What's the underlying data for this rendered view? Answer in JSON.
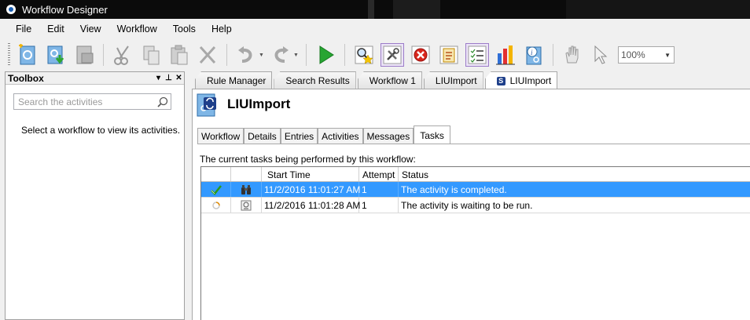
{
  "window": {
    "title": "Workflow Designer"
  },
  "menu": [
    "File",
    "Edit",
    "View",
    "Workflow",
    "Tools",
    "Help"
  ],
  "toolbar": {
    "zoom": "100%"
  },
  "toolbox": {
    "title": "Toolbox",
    "search_placeholder": "Search the activities",
    "empty_message": "Select a workflow to view its activities."
  },
  "doc_tabs": [
    {
      "label": "Rule Manager"
    },
    {
      "label": "Search Results"
    },
    {
      "label": "Workflow 1"
    },
    {
      "label": "LIUImport"
    },
    {
      "label": "LIUImport",
      "active": true
    }
  ],
  "workflow": {
    "title": "LIUImport"
  },
  "sub_tabs": [
    "Workflow",
    "Details",
    "Entries",
    "Activities",
    "Messages",
    "Tasks"
  ],
  "tasks": {
    "description": "The current tasks being performed by this workflow:",
    "columns": [
      "",
      "",
      "Start Time",
      "Attempt",
      "Status"
    ],
    "rows": [
      {
        "start_time": "11/2/2016 11:01:27 AM",
        "attempt": "1",
        "status": "The activity is completed.",
        "state_icon": "check-icon",
        "type_icon": "binoculars-icon"
      },
      {
        "start_time": "11/2/2016 11:01:28 AM",
        "attempt": "1",
        "status": "The activity is waiting to be run.",
        "state_icon": "pending-icon",
        "type_icon": "activity-doc-icon"
      }
    ]
  },
  "colors": {
    "selection": "#3399ff",
    "titlebar": "#0b0b0b"
  }
}
